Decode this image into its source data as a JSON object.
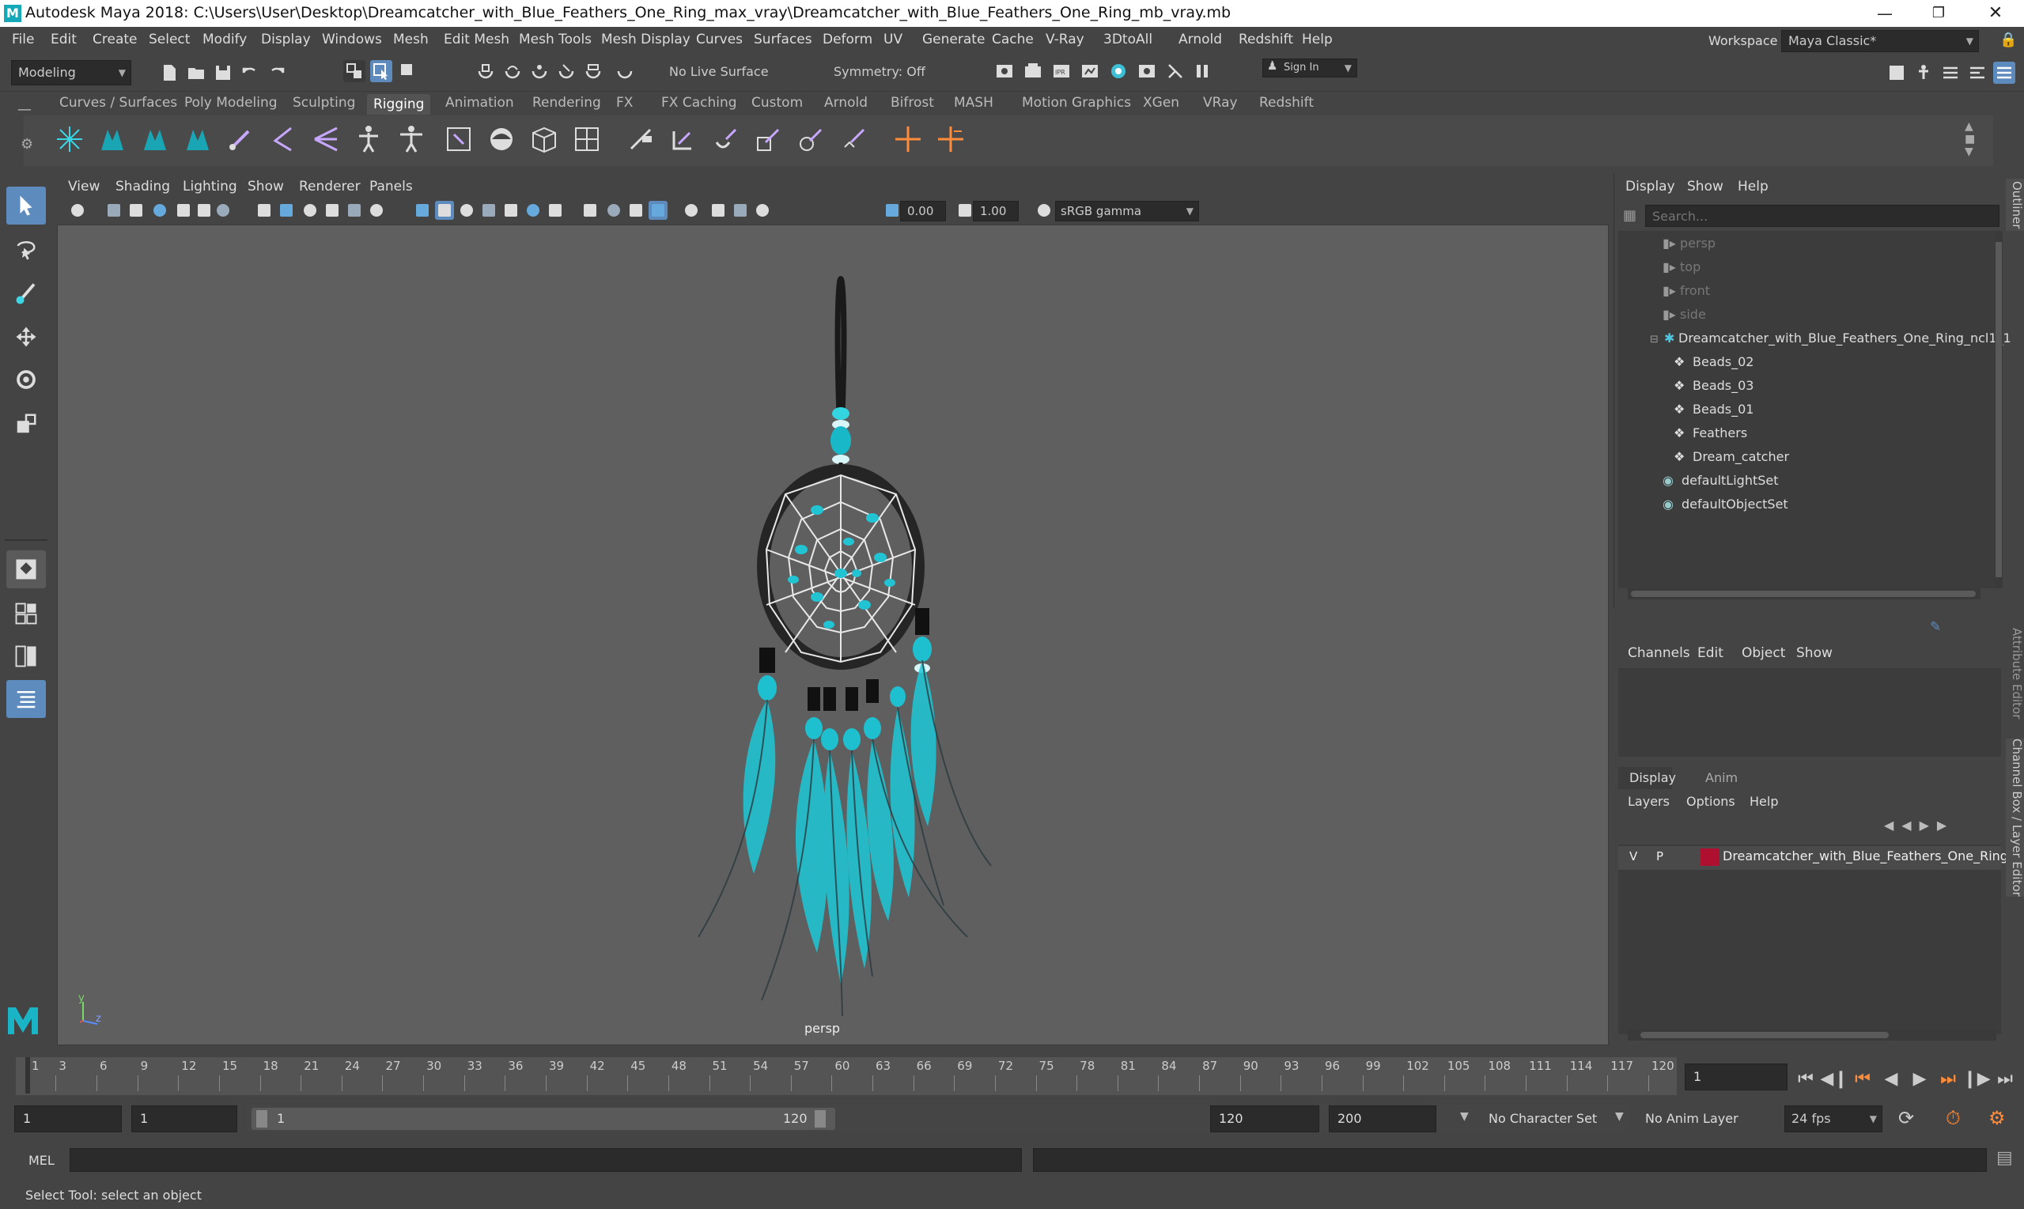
{
  "window": {
    "title": "Autodesk Maya 2018: C:\\Users\\User\\Desktop\\Dreamcatcher_with_Blue_Feathers_One_Ring_max_vray\\Dreamcatcher_with_Blue_Feathers_One_Ring_mb_vray.mb",
    "logo": "M"
  },
  "menu": [
    "File",
    "Edit",
    "Create",
    "Select",
    "Modify",
    "Display",
    "Windows",
    "Mesh",
    "Edit Mesh",
    "Mesh Tools",
    "Mesh Display",
    "Curves",
    "Surfaces",
    "Deform",
    "UV",
    "Generate",
    "Cache",
    "V-Ray",
    "3DtoAll",
    "Arnold",
    "Redshift",
    "Help"
  ],
  "workspace": {
    "label": "Workspace :",
    "value": "Maya Classic*"
  },
  "statusline": {
    "mode": "Modeling",
    "live_surface": "No Live Surface",
    "symmetry": "Symmetry: Off",
    "sign_in": "Sign In"
  },
  "shelf_tabs": [
    "Curves / Surfaces",
    "Poly Modeling",
    "Sculpting",
    "Rigging",
    "Animation",
    "Rendering",
    "FX",
    "FX Caching",
    "Custom",
    "Arnold",
    "Bifrost",
    "MASH",
    "Motion Graphics",
    "XGen",
    "VRay",
    "Redshift"
  ],
  "shelf_active": "Rigging",
  "viewport": {
    "menu": [
      "View",
      "Shading",
      "Lighting",
      "Show",
      "Renderer",
      "Panels"
    ],
    "exposure": "0.00",
    "gamma": "1.00",
    "color_space": "sRGB gamma",
    "camera_label": "persp",
    "axis_y": "y",
    "axis_z": "z"
  },
  "outliner": {
    "menu": [
      "Display",
      "Show",
      "Help"
    ],
    "search_placeholder": "Search...",
    "items": [
      {
        "label": "persp",
        "kind": "camera",
        "dim": true
      },
      {
        "label": "top",
        "kind": "camera",
        "dim": true
      },
      {
        "label": "front",
        "kind": "camera",
        "dim": true
      },
      {
        "label": "side",
        "kind": "camera",
        "dim": true
      },
      {
        "label": "Dreamcatcher_with_Blue_Feathers_One_Ring_ncl1_1",
        "kind": "group",
        "dim": false
      },
      {
        "label": "Beads_02",
        "kind": "mesh",
        "dim": false
      },
      {
        "label": "Beads_03",
        "kind": "mesh",
        "dim": false
      },
      {
        "label": "Beads_01",
        "kind": "mesh",
        "dim": false
      },
      {
        "label": "Feathers",
        "kind": "mesh",
        "dim": false
      },
      {
        "label": "Dream_catcher",
        "kind": "mesh",
        "dim": false
      },
      {
        "label": "defaultLightSet",
        "kind": "set",
        "dim": false
      },
      {
        "label": "defaultObjectSet",
        "kind": "set",
        "dim": false
      }
    ]
  },
  "channelbox": {
    "menu": [
      "Channels",
      "Edit",
      "Object",
      "Show"
    ]
  },
  "layer_editor": {
    "tabs": [
      "Display",
      "Anim"
    ],
    "menu": [
      "Layers",
      "Options",
      "Help"
    ],
    "layer": {
      "v": "V",
      "p": "P",
      "color": "#b01030",
      "name": "Dreamcatcher_with_Blue_Feathers_One_Ring"
    }
  },
  "side_tabs": [
    "Outliner",
    "Attribute Editor",
    "Channel Box / Layer Editor"
  ],
  "timeline": {
    "ticks": [
      "1",
      "3",
      "6",
      "9",
      "12",
      "15",
      "18",
      "21",
      "24",
      "27",
      "30",
      "33",
      "36",
      "39",
      "42",
      "45",
      "48",
      "51",
      "54",
      "57",
      "60",
      "63",
      "66",
      "69",
      "72",
      "75",
      "78",
      "81",
      "84",
      "87",
      "90",
      "93",
      "96",
      "99",
      "102",
      "105",
      "108",
      "111",
      "114",
      "117",
      "120"
    ],
    "current_frame": "1"
  },
  "range": {
    "start": "1",
    "start_inner": "1",
    "slider_start": "1",
    "slider_end": "120",
    "end_inner": "120",
    "end": "200",
    "character_set": "No Character Set",
    "anim_layer": "No Anim Layer",
    "fps": "24 fps"
  },
  "command": {
    "lang": "MEL"
  },
  "help_line": "Select Tool: select an object",
  "colors": {
    "accent": "#5d8bbd",
    "viewport_bg": "#5f5f5f",
    "feather": "#1ec8d8",
    "layer_color": "#b01030"
  }
}
